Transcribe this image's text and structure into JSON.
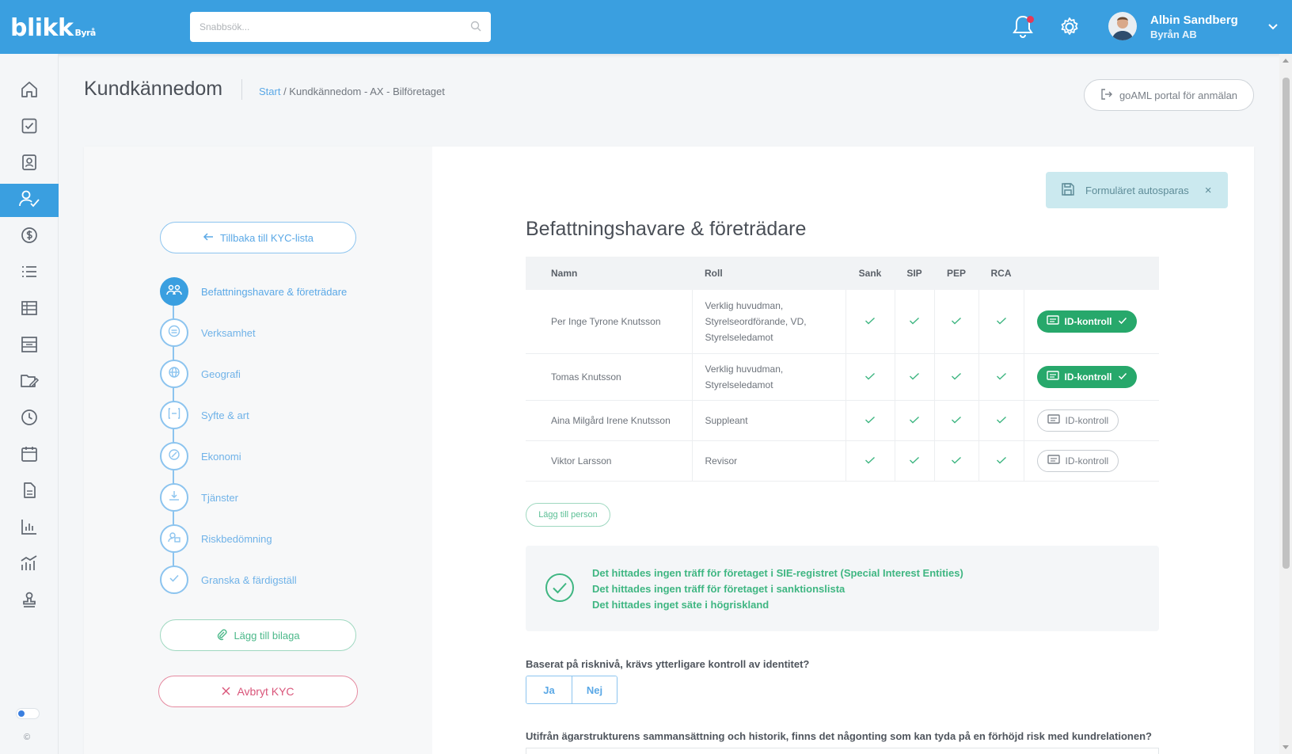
{
  "app": {
    "logo_text": "blikk",
    "logo_sub": "Byrå",
    "search_placeholder": "Snabbsök...",
    "user_name": "Albin Sandberg",
    "user_company": "Byrån AB",
    "accent_color": "#3a9fe0"
  },
  "sidebar": {
    "items": [
      {
        "icon": "home-icon"
      },
      {
        "icon": "checkbox-icon"
      },
      {
        "icon": "contact-card-icon"
      },
      {
        "icon": "user-check-icon",
        "active": true
      },
      {
        "icon": "dollar-icon"
      },
      {
        "icon": "list-icon"
      },
      {
        "icon": "table-icon"
      },
      {
        "icon": "calculator-icon"
      },
      {
        "icon": "folder-edit-icon"
      },
      {
        "icon": "clock-icon"
      },
      {
        "icon": "calendar-icon"
      },
      {
        "icon": "document-icon"
      },
      {
        "icon": "bar-chart-icon"
      },
      {
        "icon": "analytics-icon"
      },
      {
        "icon": "stamp-icon"
      }
    ],
    "copyright": "©"
  },
  "header": {
    "title": "Kundkännedom",
    "breadcrumb_link": "Start",
    "breadcrumb_rest": " / Kundkännedom - AX - Bilföretaget",
    "goaml_label": "goAML portal för anmälan"
  },
  "left_panel": {
    "back_label": "Tillbaka till KYC-lista",
    "steps": [
      {
        "label": "Befattningshavare & företrädare",
        "icon": "people-icon",
        "active": true
      },
      {
        "label": "Verksamhet",
        "icon": "building-icon"
      },
      {
        "label": "Geografi",
        "icon": "globe-icon"
      },
      {
        "label": "Syfte & art",
        "icon": "target-icon"
      },
      {
        "label": "Ekonomi",
        "icon": "coins-icon"
      },
      {
        "label": "Tjänster",
        "icon": "service-icon"
      },
      {
        "label": "Riskbedömning",
        "icon": "risk-icon"
      },
      {
        "label": "Granska & färdigställ",
        "icon": "check-icon"
      }
    ],
    "attach_label": "Lägg till bilaga",
    "cancel_label": "Avbryt KYC"
  },
  "autosave": {
    "label": "Formuläret autosparas"
  },
  "main": {
    "section_title": "Befattningshavare & företrädare",
    "table": {
      "headers": [
        "Namn",
        "Roll",
        "Sank",
        "SIP",
        "PEP",
        "RCA"
      ],
      "rows": [
        {
          "name": "Per Inge Tyrone Knutsson",
          "role": [
            "Verklig huvudman,",
            "Styrelseordförande, VD,",
            "Styrelseledamot"
          ],
          "id_label": "ID-kontroll",
          "id_done": true
        },
        {
          "name": "Tomas Knutsson",
          "role": [
            "Verklig huvudman,",
            "Styrelseledamot"
          ],
          "id_label": "ID-kontroll",
          "id_done": true
        },
        {
          "name": "Aina Milgård Irene Knutsson",
          "role": [
            "Suppleant"
          ],
          "id_label": "ID-kontroll",
          "id_done": false
        },
        {
          "name": "Viktor Larsson",
          "role": [
            "Revisor"
          ],
          "id_label": "ID-kontroll",
          "id_done": false
        }
      ]
    },
    "add_person_label": "Lägg till person",
    "info_lines": [
      "Det hittades ingen träff för företaget i SIE-registret (Special Interest Entities)",
      "Det hittades ingen träff för företaget i sanktionslista",
      "Det hittades inget säte i högriskland"
    ],
    "question1": "Baserat på risknivå, krävs ytterligare kontroll av identitet?",
    "answer_yes": "Ja",
    "answer_no": "Nej",
    "question2": "Utifrån ägarstrukturens sammansättning och historik, finns det någonting som kan tyda på en förhöjd risk med kundrelationen?"
  }
}
